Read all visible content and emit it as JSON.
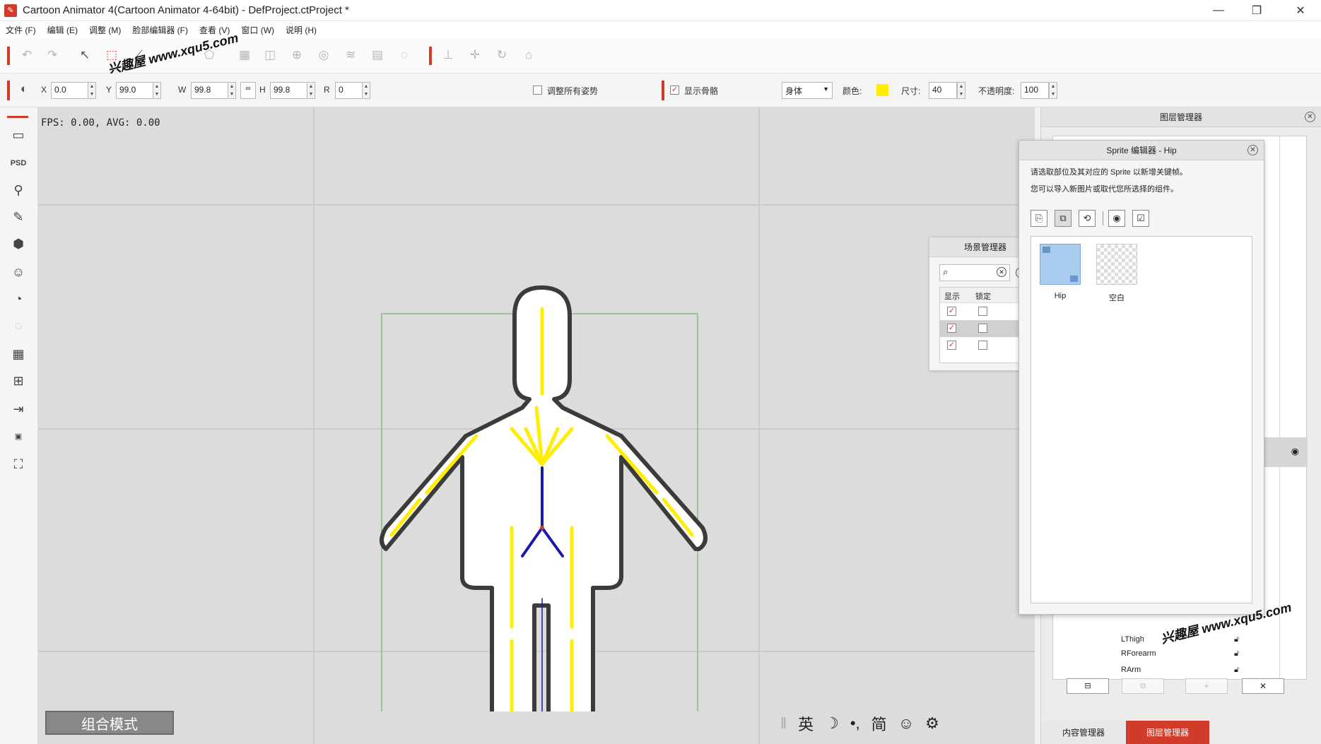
{
  "window": {
    "title": "Cartoon Animator 4(Cartoon Animator 4-64bit) - DefProject.ctProject *",
    "icon": "app-logo-icon",
    "controls": [
      "minimize-icon",
      "restore-icon",
      "close-icon"
    ]
  },
  "menu": {
    "items": [
      "文件 (F)",
      "编辑 (E)",
      "调整 (M)",
      "脸部编辑器 (F)",
      "查看 (V)",
      "窗口 (W)",
      "说明 (H)"
    ]
  },
  "watermark": {
    "top": "兴趣屋 www.xqu5.com",
    "bottom": "兴趣屋 www.xqu5.com"
  },
  "properties": {
    "x_label": "X",
    "x_value": "0.0",
    "y_label": "Y",
    "y_value": "99.0",
    "w_label": "W",
    "w_value": "99.8",
    "h_label": "H",
    "h_value": "99.8",
    "r_label": "R",
    "r_value": "0",
    "adjust_all_poses": "调整所有姿势",
    "show_bones": "显示骨骼",
    "body_select": "身体",
    "color_label": "颜色:",
    "bone_color": "#ffee00",
    "size_label": "尺寸:",
    "size_value": "40",
    "opacity_label": "不透明度:",
    "opacity_value": "100"
  },
  "canvas": {
    "fps": "FPS: 0.00, AVG: 0.00",
    "mode_button": "组合模式",
    "ime": {
      "lang": "英",
      "moon": "☽",
      "punct": "•,",
      "simplified": "简",
      "emoji": "☺",
      "settings": "⚙"
    }
  },
  "scene_manager": {
    "title": "场景管理器",
    "col_show": "显示",
    "col_lock": "锁定"
  },
  "layer_manager": {
    "title": "图层管理器",
    "visible_rows": [
      {
        "name": "LThigh"
      },
      {
        "name": "RForearm"
      },
      {
        "name": "RArm"
      }
    ],
    "tab_content": "内容管理器",
    "tab_layer": "图层管理器"
  },
  "sprite_editor": {
    "title": "Sprite 编辑器 - Hip",
    "instruction_line1": "请选取部位及其对应的 Sprite 以新增关键帧。",
    "instruction_line2": "您可以导入新图片或取代您所选择的组件。",
    "sprites": [
      {
        "label": "Hip"
      },
      {
        "label": "空白"
      }
    ]
  },
  "colors": {
    "accent_red": "#d23b2a",
    "canvas_bg": "#dcdcdc",
    "bone_yellow": "#ffee00",
    "selection_green": "#7ab87a"
  }
}
